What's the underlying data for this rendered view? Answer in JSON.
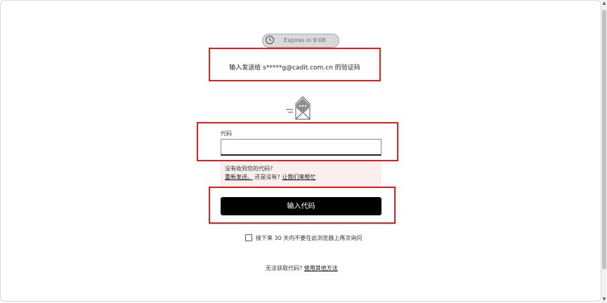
{
  "timer": {
    "text": "Expires in 9:08",
    "icon": "clock-icon"
  },
  "instruction": {
    "text": "输入发送给 s*****g@cadit.com.cn 的验证码"
  },
  "envelope": {
    "icon": "envelope-with-message-icon"
  },
  "code": {
    "label": "代码",
    "value": "",
    "placeholder": ""
  },
  "help": {
    "line1": "没有收到您的代码?",
    "resend_link": "重新发送。",
    "middle_text": "还是没有?",
    "help_link": "让我们来帮忙"
  },
  "submit": {
    "label": "输入代码"
  },
  "remember": {
    "checked": false,
    "text": "接下来 30 天内不要在此浏览器上再次询问"
  },
  "alternative": {
    "prompt": "无法获取代码?",
    "link": "使用其他方法"
  },
  "colors": {
    "highlight_border": "#e01e1e",
    "button_bg": "#000000",
    "help_bg": "#fbeeee",
    "timer_bg": "#d9d9d9"
  }
}
